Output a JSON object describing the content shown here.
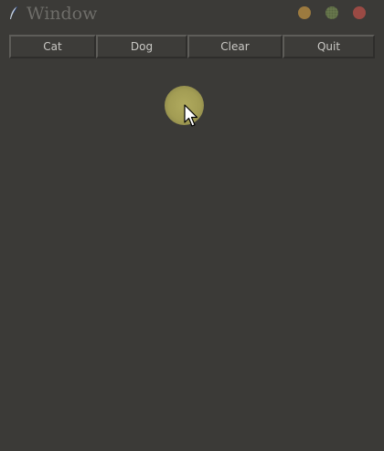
{
  "window": {
    "title": "Window",
    "icon": "feather-icon",
    "controls": {
      "minimize_color": "#9c7a3f",
      "maximize_color": "#6a7a4e",
      "close_color": "#9a4a44"
    }
  },
  "toolbar": {
    "buttons": [
      {
        "label": "Cat"
      },
      {
        "label": "Dog"
      },
      {
        "label": "Clear"
      },
      {
        "label": "Quit"
      }
    ]
  },
  "canvas": {
    "background": "#3b3a37",
    "click_highlight_color": "#a39d54",
    "cursor": "arrow-cursor-icon"
  }
}
